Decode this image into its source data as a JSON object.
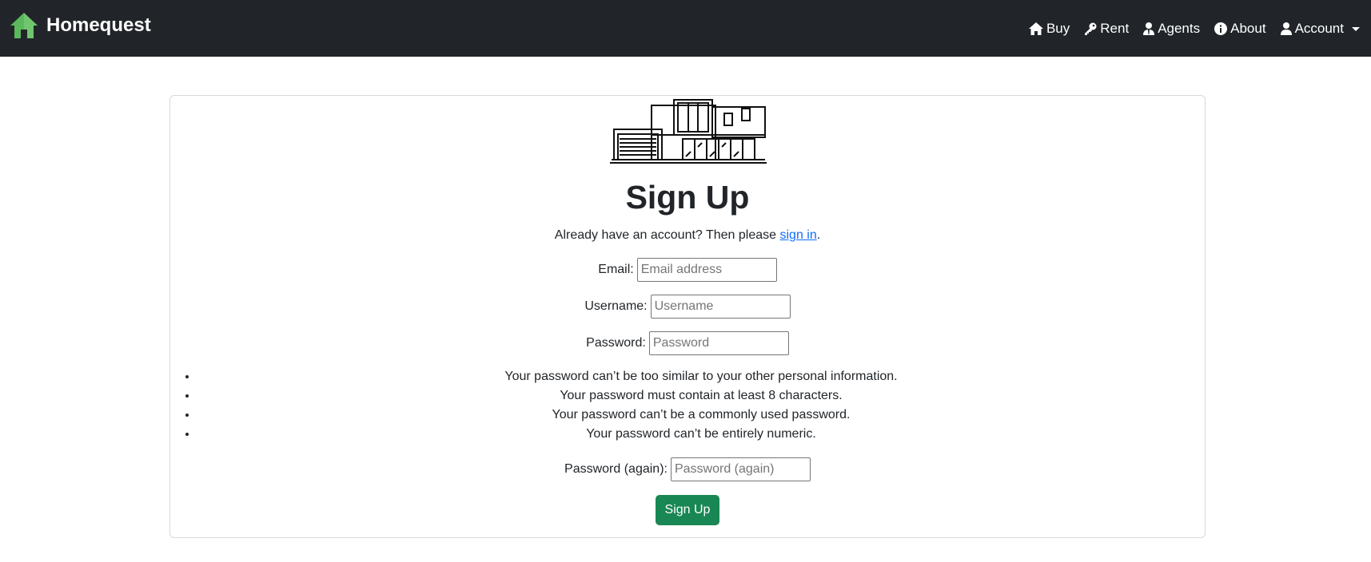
{
  "nav": {
    "brand": "Homequest",
    "items": [
      {
        "label": "Buy",
        "icon": "house-icon"
      },
      {
        "label": "Rent",
        "icon": "key-icon"
      },
      {
        "label": "Agents",
        "icon": "agent-icon"
      },
      {
        "label": "About",
        "icon": "info-icon"
      },
      {
        "label": "Account",
        "icon": "user-icon"
      }
    ]
  },
  "colors": {
    "navbar_bg": "#212529",
    "brand_logo": "#5cb85c",
    "link": "#0d6efd",
    "button_bg": "#198754"
  },
  "form": {
    "title": "Sign Up",
    "signin_prefix": "Already have an account? Then please ",
    "signin_link": "sign in",
    "signin_suffix": ".",
    "email_label": "Email:",
    "email_placeholder": "Email address",
    "username_label": "Username:",
    "username_placeholder": "Username",
    "password_label": "Password:",
    "password_placeholder": "Password",
    "password_help": [
      "Your password can’t be too similar to your other personal information.",
      "Your password must contain at least 8 characters.",
      "Your password can’t be a commonly used password.",
      "Your password can’t be entirely numeric."
    ],
    "password2_label": "Password (again):",
    "password2_placeholder": "Password (again)",
    "submit_label": "Sign Up"
  }
}
